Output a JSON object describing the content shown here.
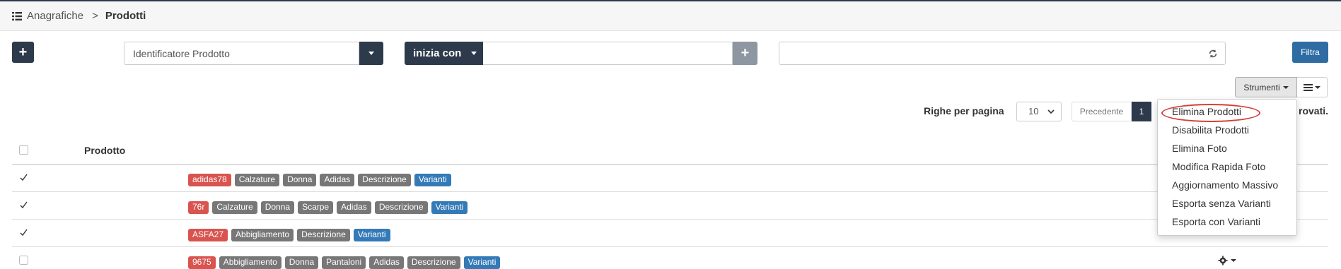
{
  "breadcrumb": {
    "icon": "list-icon",
    "parent": "Anagrafiche",
    "separator": ">",
    "current": "Prodotti"
  },
  "toolbar": {
    "add_label": "+",
    "filter_label": "Filtra"
  },
  "filter": {
    "field": "Identificatore Prodotto",
    "operator": "inizia con",
    "value": "",
    "add_condition_label": "+",
    "search_value": ""
  },
  "tools": {
    "strumenti_label": "Strumenti",
    "columns_icon": "menu-icon"
  },
  "pagination": {
    "rows_label": "Righe per pagina",
    "rows_value": "10",
    "prev_label": "Precedente",
    "current_page": "1",
    "found_text": "rovati."
  },
  "table": {
    "header": {
      "product_label": "Prodotto"
    },
    "rows": [
      {
        "checked": true,
        "labels": [
          {
            "text": "adidas78",
            "color": "red"
          },
          {
            "text": "Calzature",
            "color": "gray"
          },
          {
            "text": "Donna",
            "color": "gray"
          },
          {
            "text": "Adidas",
            "color": "gray"
          },
          {
            "text": "Descrizione",
            "color": "gray"
          },
          {
            "text": "Varianti",
            "color": "blue"
          }
        ]
      },
      {
        "checked": true,
        "labels": [
          {
            "text": "76r",
            "color": "red"
          },
          {
            "text": "Calzature",
            "color": "gray"
          },
          {
            "text": "Donna",
            "color": "gray"
          },
          {
            "text": "Scarpe",
            "color": "gray"
          },
          {
            "text": "Adidas",
            "color": "gray"
          },
          {
            "text": "Descrizione",
            "color": "gray"
          },
          {
            "text": "Varianti",
            "color": "blue"
          }
        ]
      },
      {
        "checked": true,
        "labels": [
          {
            "text": "ASFA27",
            "color": "red"
          },
          {
            "text": "Abbigliamento",
            "color": "gray"
          },
          {
            "text": "Descrizione",
            "color": "gray"
          },
          {
            "text": "Varianti",
            "color": "blue"
          }
        ]
      },
      {
        "checked": false,
        "labels": [
          {
            "text": "9675",
            "color": "red"
          },
          {
            "text": "Abbigliamento",
            "color": "gray"
          },
          {
            "text": "Donna",
            "color": "gray"
          },
          {
            "text": "Pantaloni",
            "color": "gray"
          },
          {
            "text": "Adidas",
            "color": "gray"
          },
          {
            "text": "Descrizione",
            "color": "gray"
          },
          {
            "text": "Varianti",
            "color": "blue"
          }
        ]
      }
    ]
  },
  "dropdown_menu": {
    "items": [
      "Elimina Prodotti",
      "Disabilita Prodotti",
      "Elimina Foto",
      "Modifica Rapida Foto",
      "Aggiornamento Massivo",
      "Esporta senza Varianti",
      "Esporta con Varianti"
    ],
    "highlighted_index": 0
  },
  "colors": {
    "dark": "#2d3a4b",
    "primary": "#2f6ca3",
    "danger": "#d9534f",
    "gray_label": "#777777",
    "info": "#337ab7",
    "annotation": "#d43f3a"
  }
}
